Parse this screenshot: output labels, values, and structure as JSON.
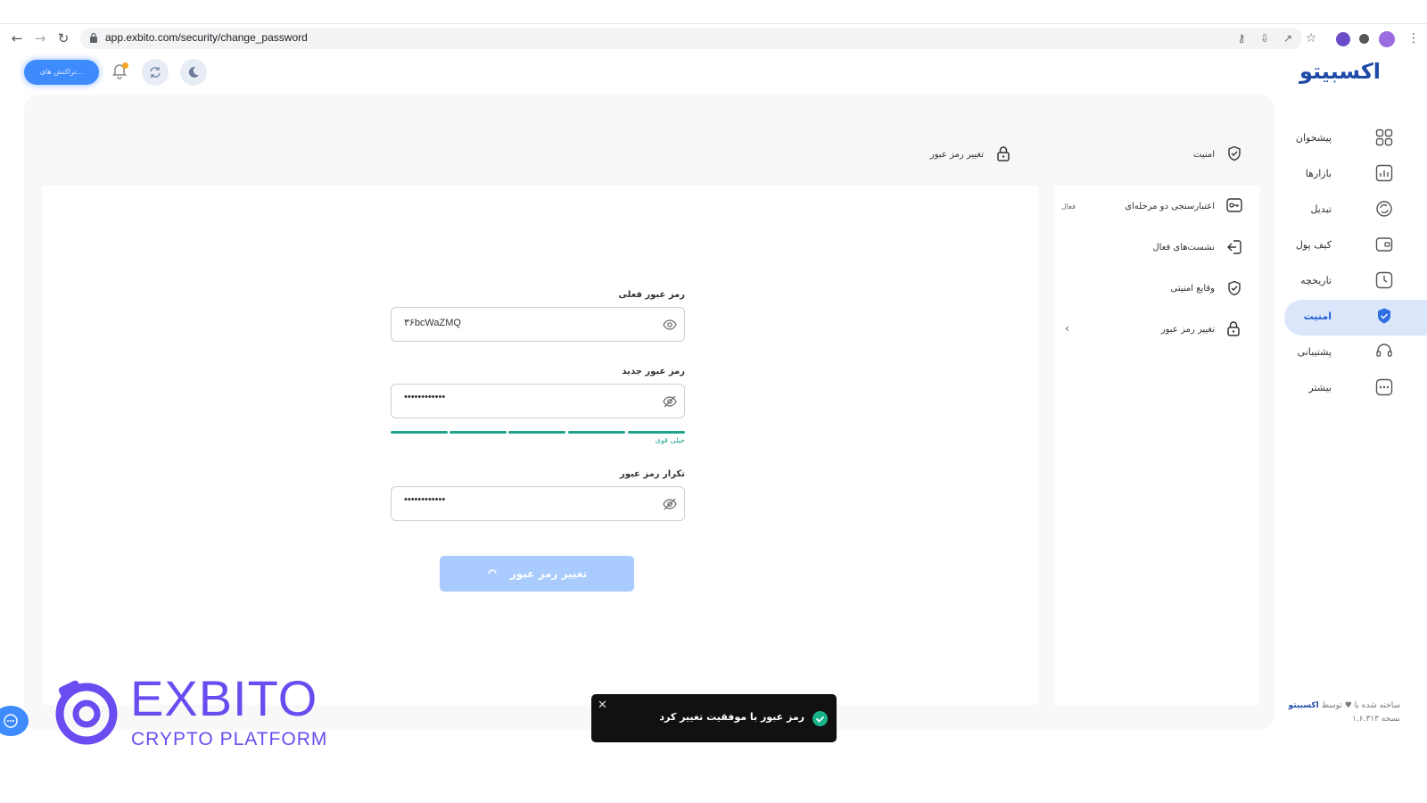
{
  "browser": {
    "url": "app.exbito.com/security/change_password"
  },
  "header": {
    "brand": "اکسبیتو",
    "action_pill_label": "تراکنش های..."
  },
  "sidebar": {
    "items": [
      {
        "label": "پیشخوان",
        "icon": "grid-icon"
      },
      {
        "label": "بازارها",
        "icon": "chart-icon"
      },
      {
        "label": "تبدیل",
        "icon": "convert-icon"
      },
      {
        "label": "کیف پول",
        "icon": "wallet-icon"
      },
      {
        "label": "تاریخچه",
        "icon": "clock-icon"
      },
      {
        "label": "امنیت",
        "icon": "shield-icon",
        "active": true
      },
      {
        "label": "پشتیبانی",
        "icon": "headset-icon"
      },
      {
        "label": "بیشتر",
        "icon": "more-icon"
      }
    ],
    "footer_line1_prefix": "ساخته شده با",
    "footer_line1_by": "توسط",
    "footer_line1_brand": "اکسبیتو",
    "footer_line2": "نسخه ۱.۶.۳۱۳"
  },
  "security_menu": {
    "title": "امنیت",
    "items": [
      {
        "label": "اعتبارسنجی دو مرحله‌ای",
        "badge": "فعال"
      },
      {
        "label": "نشست‌های فعال"
      },
      {
        "label": "وقایع امنیتی"
      },
      {
        "label": "تغییر رمز عبور"
      }
    ]
  },
  "form": {
    "title": "تغییر رمز عبور",
    "current_label": "رمز عبور فعلی",
    "current_value": "۳۶bcWaZMQ",
    "new_label": "رمز عبور جدید",
    "new_value": "••••••••••••",
    "strength_label": "خیلی قوی",
    "strength_level": 5,
    "strength_max": 5,
    "confirm_label": "تکرار رمز عبور",
    "confirm_value": "••••••••••••",
    "submit_label": "تغییر رمز عبور"
  },
  "toast": {
    "message": "رمز عبور با موفقیت تغییر کرد"
  },
  "watermark": {
    "line1": "EXBITO",
    "line2": "CRYPTO PLATFORM"
  },
  "colors": {
    "primary": "#3d8bfd",
    "brand_text": "#1f4aa8",
    "strength_good": "#21a38a",
    "watermark": "#6a4cf0"
  }
}
